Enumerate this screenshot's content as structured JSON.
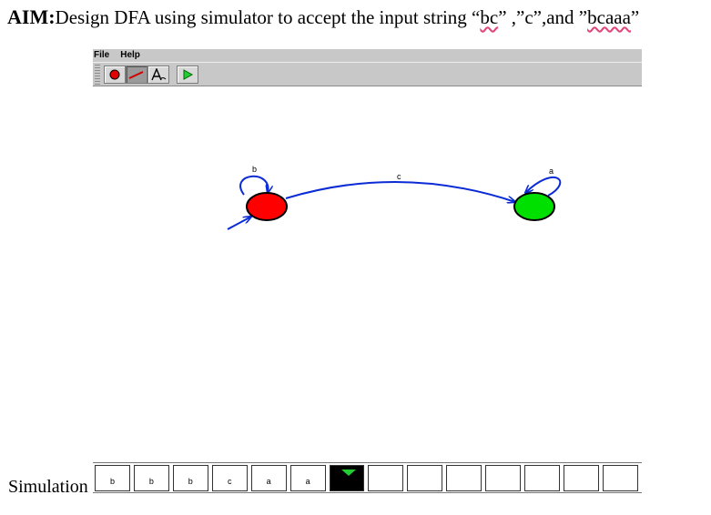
{
  "aim": {
    "label": "AIM:",
    "text_1": "Design DFA  using simulator to accept the input string “",
    "s1": "bc",
    "text_2": "” ,”c”,and ”",
    "s2": "bcaaa",
    "text_3": "”"
  },
  "app": {
    "menu": [
      "File",
      "Help"
    ],
    "toolbar": [
      {
        "icon": "add-state-icon",
        "pressed": false
      },
      {
        "icon": "add-transition-icon",
        "pressed": true
      },
      {
        "icon": "label-tool-icon",
        "pressed": false
      },
      {
        "icon": "run-simulation-icon",
        "pressed": false
      }
    ]
  },
  "diagram": {
    "states": [
      {
        "id": "q0",
        "role": "start",
        "color": "#ff0000"
      },
      {
        "id": "q1",
        "role": "accept",
        "color": "#00e000"
      }
    ],
    "transitions": [
      {
        "from": "q0",
        "to": "q0",
        "label": "b"
      },
      {
        "from": "q0",
        "to": "q1",
        "label": "c"
      },
      {
        "from": "q1",
        "to": "q1",
        "label": "a"
      }
    ],
    "edge_color": "#0a2bd6"
  },
  "simulation": {
    "label": "Simulation",
    "tape": [
      "b",
      "b",
      "b",
      "c",
      "a",
      "a",
      "",
      "",
      "",
      "",
      "",
      "",
      "",
      ""
    ],
    "head_index": 6,
    "head_color": "#22cc33"
  }
}
